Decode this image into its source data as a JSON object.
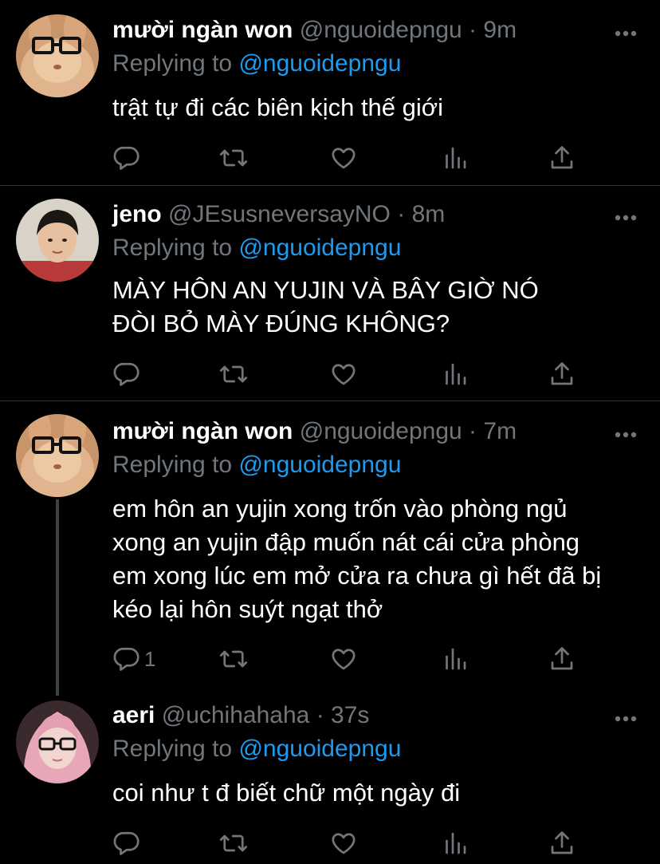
{
  "tweets": [
    {
      "name": "mười ngàn won",
      "handle": "@nguoidepngu",
      "separator": "·",
      "time": "9m",
      "replying_label": "Replying to",
      "replying_handle": "@nguoidepngu",
      "text": "trật tự đi các biên kịch thế giới",
      "avatar": "rabbit-with-glasses-avatar",
      "reply_count": ""
    },
    {
      "name": "jeno",
      "handle": "@JEsusneversayNO",
      "separator": "·",
      "time": "8m",
      "replying_label": "Replying to",
      "replying_handle": "@nguoidepngu",
      "text": "MÀY HÔN AN YUJIN VÀ BÂY GIỜ NÓ ĐÒI BỎ MÀY ĐÚNG KHÔNG?",
      "avatar": "boy-portrait-avatar",
      "reply_count": ""
    },
    {
      "name": "mười ngàn won",
      "handle": "@nguoidepngu",
      "separator": "·",
      "time": "7m",
      "replying_label": "Replying to",
      "replying_handle": "@nguoidepngu",
      "text": "em hôn an yujin xong trốn vào phòng ngủ xong an yujin đập muốn nát cái cửa phòng em xong lúc em mở cửa ra chưa gì hết đã bị kéo lại hôn suýt ngạt thở",
      "avatar": "rabbit-with-glasses-avatar",
      "reply_count": "1"
    },
    {
      "name": "aeri",
      "handle": "@uchihahaha",
      "separator": "·",
      "time": "37s",
      "replying_label": "Replying to",
      "replying_handle": "@nguoidepngu",
      "text": "coi như t đ biết chữ một ngày đi",
      "avatar": "pink-hair-glasses-avatar",
      "reply_count": ""
    }
  ],
  "colors": {
    "background": "#000000",
    "text": "#ffffff",
    "muted": "#71767b",
    "link": "#1d9bf0",
    "divider": "#2f3336"
  }
}
